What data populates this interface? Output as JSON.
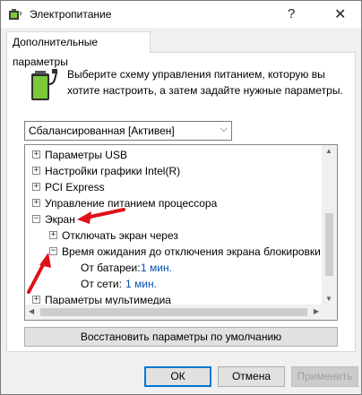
{
  "window": {
    "title": "Электропитание",
    "help_glyph": "?",
    "close_glyph": "✕"
  },
  "tab": {
    "label": "Дополнительные параметры"
  },
  "description": "Выберите схему управления питанием, которую вы хотите настроить, а затем задайте нужные параметры.",
  "plan_select": {
    "selected": "Сбалансированная [Активен]"
  },
  "tree": {
    "items": [
      {
        "label": "Параметры USB",
        "toggle": "+"
      },
      {
        "label": "Настройки графики Intel(R)",
        "toggle": "+"
      },
      {
        "label": "PCI Express",
        "toggle": "+"
      },
      {
        "label": "Управление питанием процессора",
        "toggle": "+"
      },
      {
        "label": "Экран",
        "toggle": "−"
      },
      {
        "label": "Отключать экран через",
        "toggle": "+"
      },
      {
        "label": "Время ожидания до отключения экрана блокировки",
        "toggle": "−"
      },
      {
        "label": "От батареи:",
        "value": "1 мин."
      },
      {
        "label": "От сети:",
        "value": "1 мин."
      },
      {
        "label": "Параметры мультимедиа",
        "toggle": "+"
      }
    ]
  },
  "restore_button": "Восстановить параметры по умолчанию",
  "buttons": {
    "ok": "ОК",
    "cancel": "Отмена",
    "apply": "Применить"
  },
  "colors": {
    "accent": "#0078d7",
    "annotation_arrow": "#e0101a",
    "value_link": "#0050b0"
  }
}
